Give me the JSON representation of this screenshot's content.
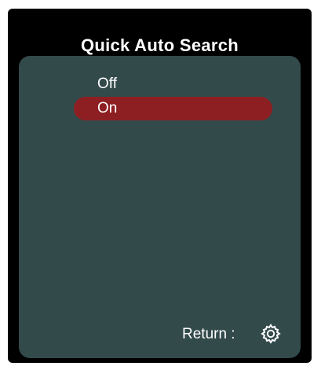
{
  "menu": {
    "title": "Quick Auto Search",
    "options": [
      {
        "label": "Off",
        "selected": false
      },
      {
        "label": "On",
        "selected": true
      }
    ],
    "selection_color": "#8d1f22",
    "panel_color": "#334a4b",
    "footer": {
      "return_label": "Return :",
      "icon": "gear-icon"
    }
  }
}
